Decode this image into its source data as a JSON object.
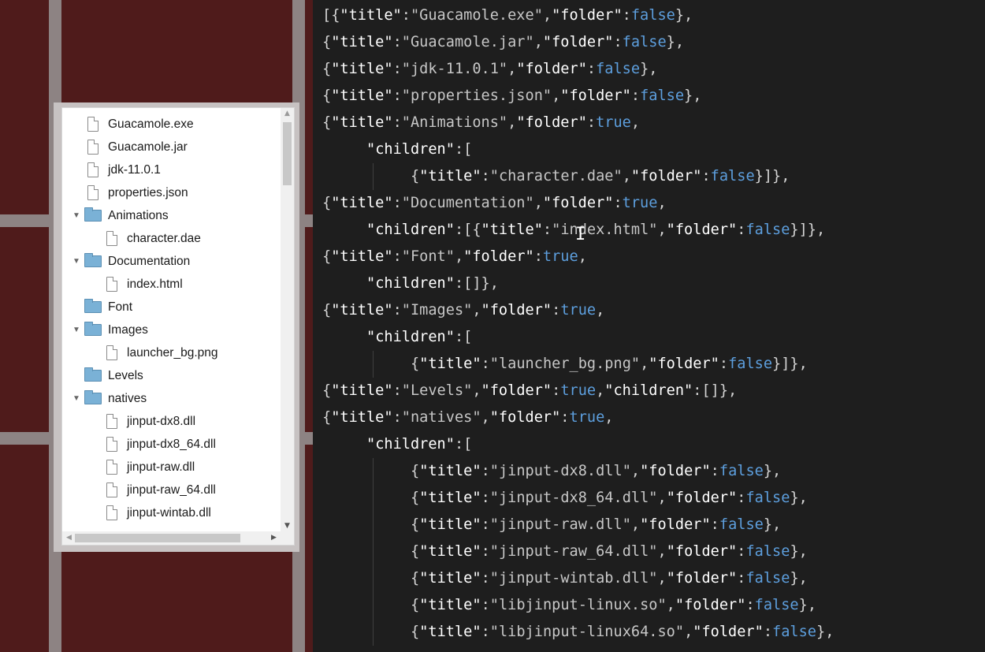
{
  "tree": {
    "items": [
      {
        "label": "Guacamole.exe",
        "type": "file",
        "depth": 0,
        "expanded": null
      },
      {
        "label": "Guacamole.jar",
        "type": "file",
        "depth": 0,
        "expanded": null
      },
      {
        "label": "jdk-11.0.1",
        "type": "file",
        "depth": 0,
        "expanded": null
      },
      {
        "label": "properties.json",
        "type": "file",
        "depth": 0,
        "expanded": null
      },
      {
        "label": "Animations",
        "type": "folder",
        "depth": 0,
        "expanded": true
      },
      {
        "label": "character.dae",
        "type": "file",
        "depth": 1,
        "expanded": null
      },
      {
        "label": "Documentation",
        "type": "folder",
        "depth": 0,
        "expanded": true
      },
      {
        "label": "index.html",
        "type": "file",
        "depth": 1,
        "expanded": null
      },
      {
        "label": "Font",
        "type": "folder",
        "depth": 0,
        "expanded": null
      },
      {
        "label": "Images",
        "type": "folder",
        "depth": 0,
        "expanded": true
      },
      {
        "label": "launcher_bg.png",
        "type": "file",
        "depth": 1,
        "expanded": null
      },
      {
        "label": "Levels",
        "type": "folder",
        "depth": 0,
        "expanded": null
      },
      {
        "label": "natives",
        "type": "folder",
        "depth": 0,
        "expanded": true
      },
      {
        "label": "jinput-dx8.dll",
        "type": "file",
        "depth": 1,
        "expanded": null
      },
      {
        "label": "jinput-dx8_64.dll",
        "type": "file",
        "depth": 1,
        "expanded": null
      },
      {
        "label": "jinput-raw.dll",
        "type": "file",
        "depth": 1,
        "expanded": null
      },
      {
        "label": "jinput-raw_64.dll",
        "type": "file",
        "depth": 1,
        "expanded": null
      },
      {
        "label": "jinput-wintab.dll",
        "type": "file",
        "depth": 1,
        "expanded": null
      }
    ]
  },
  "code": {
    "lines": [
      {
        "indent": 0,
        "segs": [
          [
            "p",
            "[{"
          ],
          [
            "key",
            "\"title\""
          ],
          [
            "p",
            ":"
          ],
          [
            "str",
            "\"Guacamole.exe\""
          ],
          [
            "p",
            ","
          ],
          [
            "key",
            "\"folder\""
          ],
          [
            "p",
            ":"
          ],
          [
            "bool",
            "false"
          ],
          [
            "p",
            "},"
          ]
        ]
      },
      {
        "indent": 0,
        "segs": [
          [
            "p",
            "{"
          ],
          [
            "key",
            "\"title\""
          ],
          [
            "p",
            ":"
          ],
          [
            "str",
            "\"Guacamole.jar\""
          ],
          [
            "p",
            ","
          ],
          [
            "key",
            "\"folder\""
          ],
          [
            "p",
            ":"
          ],
          [
            "bool",
            "false"
          ],
          [
            "p",
            "},"
          ]
        ]
      },
      {
        "indent": 0,
        "segs": [
          [
            "p",
            "{"
          ],
          [
            "key",
            "\"title\""
          ],
          [
            "p",
            ":"
          ],
          [
            "str",
            "\"jdk-11.0.1\""
          ],
          [
            "p",
            ","
          ],
          [
            "key",
            "\"folder\""
          ],
          [
            "p",
            ":"
          ],
          [
            "bool",
            "false"
          ],
          [
            "p",
            "},"
          ]
        ]
      },
      {
        "indent": 0,
        "segs": [
          [
            "p",
            "{"
          ],
          [
            "key",
            "\"title\""
          ],
          [
            "p",
            ":"
          ],
          [
            "str",
            "\"properties.json\""
          ],
          [
            "p",
            ","
          ],
          [
            "key",
            "\"folder\""
          ],
          [
            "p",
            ":"
          ],
          [
            "bool",
            "false"
          ],
          [
            "p",
            "},"
          ]
        ]
      },
      {
        "indent": 0,
        "segs": [
          [
            "p",
            "{"
          ],
          [
            "key",
            "\"title\""
          ],
          [
            "p",
            ":"
          ],
          [
            "str",
            "\"Animations\""
          ],
          [
            "p",
            ","
          ],
          [
            "key",
            "\"folder\""
          ],
          [
            "p",
            ":"
          ],
          [
            "bool",
            "true"
          ],
          [
            "p",
            ","
          ]
        ]
      },
      {
        "indent": 1,
        "segs": [
          [
            "key",
            "\"children\""
          ],
          [
            "p",
            ":["
          ]
        ]
      },
      {
        "indent": 2,
        "segs": [
          [
            "p",
            "{"
          ],
          [
            "key",
            "\"title\""
          ],
          [
            "p",
            ":"
          ],
          [
            "str",
            "\"character.dae\""
          ],
          [
            "p",
            ","
          ],
          [
            "key",
            "\"folder\""
          ],
          [
            "p",
            ":"
          ],
          [
            "bool",
            "false"
          ],
          [
            "p",
            "}]},"
          ]
        ]
      },
      {
        "indent": 0,
        "segs": [
          [
            "p",
            "{"
          ],
          [
            "key",
            "\"title\""
          ],
          [
            "p",
            ":"
          ],
          [
            "str",
            "\"Documentation\""
          ],
          [
            "p",
            ","
          ],
          [
            "key",
            "\"folder\""
          ],
          [
            "p",
            ":"
          ],
          [
            "bool",
            "true"
          ],
          [
            "p",
            ","
          ]
        ]
      },
      {
        "indent": 1,
        "segs": [
          [
            "key",
            "\"children\""
          ],
          [
            "p",
            ":[{"
          ],
          [
            "key",
            "\"title\""
          ],
          [
            "p",
            ":"
          ],
          [
            "str",
            "\"index.html\""
          ],
          [
            "p",
            ","
          ],
          [
            "key",
            "\"folder\""
          ],
          [
            "p",
            ":"
          ],
          [
            "bool",
            "false"
          ],
          [
            "p",
            "}]},"
          ]
        ]
      },
      {
        "indent": 0,
        "segs": [
          [
            "p",
            "{"
          ],
          [
            "key",
            "\"title\""
          ],
          [
            "p",
            ":"
          ],
          [
            "str",
            "\"Font\""
          ],
          [
            "p",
            ","
          ],
          [
            "key",
            "\"folder\""
          ],
          [
            "p",
            ":"
          ],
          [
            "bool",
            "true"
          ],
          [
            "p",
            ","
          ]
        ]
      },
      {
        "indent": 1,
        "segs": [
          [
            "key",
            "\"children\""
          ],
          [
            "p",
            ":[]},"
          ]
        ]
      },
      {
        "indent": 0,
        "segs": [
          [
            "p",
            "{"
          ],
          [
            "key",
            "\"title\""
          ],
          [
            "p",
            ":"
          ],
          [
            "str",
            "\"Images\""
          ],
          [
            "p",
            ","
          ],
          [
            "key",
            "\"folder\""
          ],
          [
            "p",
            ":"
          ],
          [
            "bool",
            "true"
          ],
          [
            "p",
            ","
          ]
        ]
      },
      {
        "indent": 1,
        "segs": [
          [
            "key",
            "\"children\""
          ],
          [
            "p",
            ":["
          ]
        ]
      },
      {
        "indent": 2,
        "segs": [
          [
            "p",
            "{"
          ],
          [
            "key",
            "\"title\""
          ],
          [
            "p",
            ":"
          ],
          [
            "str",
            "\"launcher_bg.png\""
          ],
          [
            "p",
            ","
          ],
          [
            "key",
            "\"folder\""
          ],
          [
            "p",
            ":"
          ],
          [
            "bool",
            "false"
          ],
          [
            "p",
            "}]},"
          ]
        ]
      },
      {
        "indent": 0,
        "segs": [
          [
            "p",
            "{"
          ],
          [
            "key",
            "\"title\""
          ],
          [
            "p",
            ":"
          ],
          [
            "str",
            "\"Levels\""
          ],
          [
            "p",
            ","
          ],
          [
            "key",
            "\"folder\""
          ],
          [
            "p",
            ":"
          ],
          [
            "bool",
            "true"
          ],
          [
            "p",
            ","
          ],
          [
            "key",
            "\"children\""
          ],
          [
            "p",
            ":[]},"
          ]
        ]
      },
      {
        "indent": 0,
        "segs": [
          [
            "p",
            "{"
          ],
          [
            "key",
            "\"title\""
          ],
          [
            "p",
            ":"
          ],
          [
            "str",
            "\"natives\""
          ],
          [
            "p",
            ","
          ],
          [
            "key",
            "\"folder\""
          ],
          [
            "p",
            ":"
          ],
          [
            "bool",
            "true"
          ],
          [
            "p",
            ","
          ]
        ]
      },
      {
        "indent": 1,
        "segs": [
          [
            "key",
            "\"children\""
          ],
          [
            "p",
            ":["
          ]
        ]
      },
      {
        "indent": 2,
        "segs": [
          [
            "p",
            "{"
          ],
          [
            "key",
            "\"title\""
          ],
          [
            "p",
            ":"
          ],
          [
            "str",
            "\"jinput-dx8.dll\""
          ],
          [
            "p",
            ","
          ],
          [
            "key",
            "\"folder\""
          ],
          [
            "p",
            ":"
          ],
          [
            "bool",
            "false"
          ],
          [
            "p",
            "},"
          ]
        ]
      },
      {
        "indent": 2,
        "segs": [
          [
            "p",
            "{"
          ],
          [
            "key",
            "\"title\""
          ],
          [
            "p",
            ":"
          ],
          [
            "str",
            "\"jinput-dx8_64.dll\""
          ],
          [
            "p",
            ","
          ],
          [
            "key",
            "\"folder\""
          ],
          [
            "p",
            ":"
          ],
          [
            "bool",
            "false"
          ],
          [
            "p",
            "},"
          ]
        ]
      },
      {
        "indent": 2,
        "segs": [
          [
            "p",
            "{"
          ],
          [
            "key",
            "\"title\""
          ],
          [
            "p",
            ":"
          ],
          [
            "str",
            "\"jinput-raw.dll\""
          ],
          [
            "p",
            ","
          ],
          [
            "key",
            "\"folder\""
          ],
          [
            "p",
            ":"
          ],
          [
            "bool",
            "false"
          ],
          [
            "p",
            "},"
          ]
        ]
      },
      {
        "indent": 2,
        "segs": [
          [
            "p",
            "{"
          ],
          [
            "key",
            "\"title\""
          ],
          [
            "p",
            ":"
          ],
          [
            "str",
            "\"jinput-raw_64.dll\""
          ],
          [
            "p",
            ","
          ],
          [
            "key",
            "\"folder\""
          ],
          [
            "p",
            ":"
          ],
          [
            "bool",
            "false"
          ],
          [
            "p",
            "},"
          ]
        ]
      },
      {
        "indent": 2,
        "segs": [
          [
            "p",
            "{"
          ],
          [
            "key",
            "\"title\""
          ],
          [
            "p",
            ":"
          ],
          [
            "str",
            "\"jinput-wintab.dll\""
          ],
          [
            "p",
            ","
          ],
          [
            "key",
            "\"folder\""
          ],
          [
            "p",
            ":"
          ],
          [
            "bool",
            "false"
          ],
          [
            "p",
            "},"
          ]
        ]
      },
      {
        "indent": 2,
        "segs": [
          [
            "p",
            "{"
          ],
          [
            "key",
            "\"title\""
          ],
          [
            "p",
            ":"
          ],
          [
            "str",
            "\"libjinput-linux.so\""
          ],
          [
            "p",
            ","
          ],
          [
            "key",
            "\"folder\""
          ],
          [
            "p",
            ":"
          ],
          [
            "bool",
            "false"
          ],
          [
            "p",
            "},"
          ]
        ]
      },
      {
        "indent": 2,
        "segs": [
          [
            "p",
            "{"
          ],
          [
            "key",
            "\"title\""
          ],
          [
            "p",
            ":"
          ],
          [
            "str",
            "\"libjinput-linux64.so\""
          ],
          [
            "p",
            ","
          ],
          [
            "key",
            "\"folder\""
          ],
          [
            "p",
            ":"
          ],
          [
            "bool",
            "false"
          ],
          [
            "p",
            "},"
          ]
        ]
      }
    ]
  },
  "colors": {
    "key": "#ffffff",
    "string": "#c7c7c7",
    "boolean": "#5d9fde",
    "punctuation": "#d4d4d4",
    "code_background": "#1e1e1e",
    "left_background": "#4f1b1b"
  },
  "icons": {
    "file": "file-icon",
    "folder": "folder-icon",
    "expanded": "triangle-down-icon",
    "text_cursor": "i-beam-cursor-icon"
  }
}
